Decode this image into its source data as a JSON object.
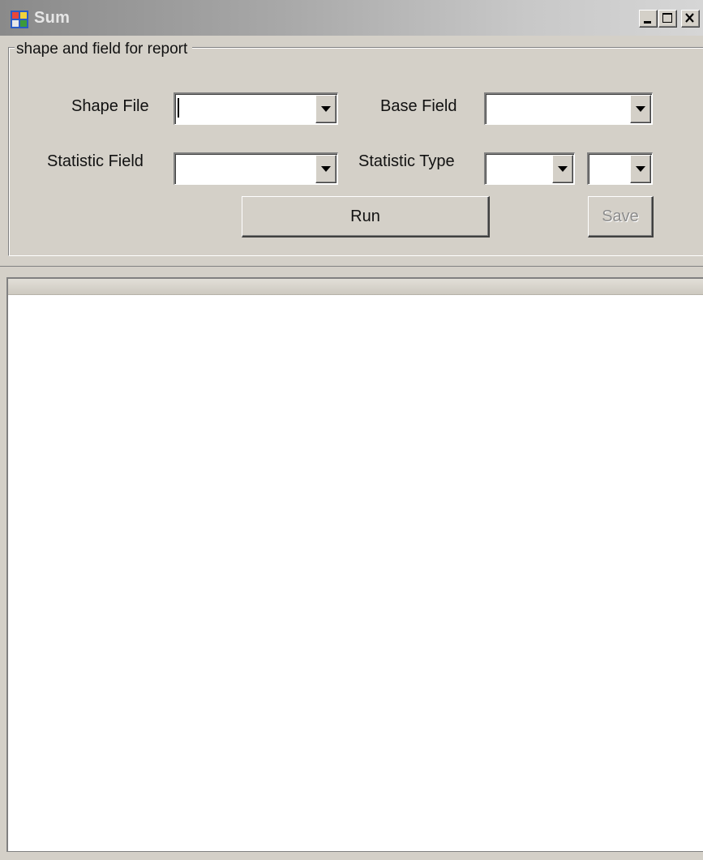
{
  "window": {
    "title": "Sum",
    "icon": "windows-form-icon",
    "caption_buttons": [
      "minimize",
      "maximize",
      "close"
    ]
  },
  "groupbox": {
    "legend": "shape and field for report"
  },
  "form": {
    "shape_file_label": "Shape File",
    "shape_file_value": "",
    "base_field_label": "Base Field",
    "base_field_value": "",
    "statistic_field_label": "Statistic Field",
    "statistic_field_value": "",
    "statistic_type_label": "Statistic Type",
    "statistic_type_value": "",
    "statistic_type_extra_value": ""
  },
  "buttons": {
    "run_label": "Run",
    "save_label": "Save",
    "save_enabled": false
  },
  "colors": {
    "face": "#d4d0c8",
    "shadow": "#808080",
    "highlight": "#ffffff",
    "disabled_text": "#8c8c8c"
  }
}
